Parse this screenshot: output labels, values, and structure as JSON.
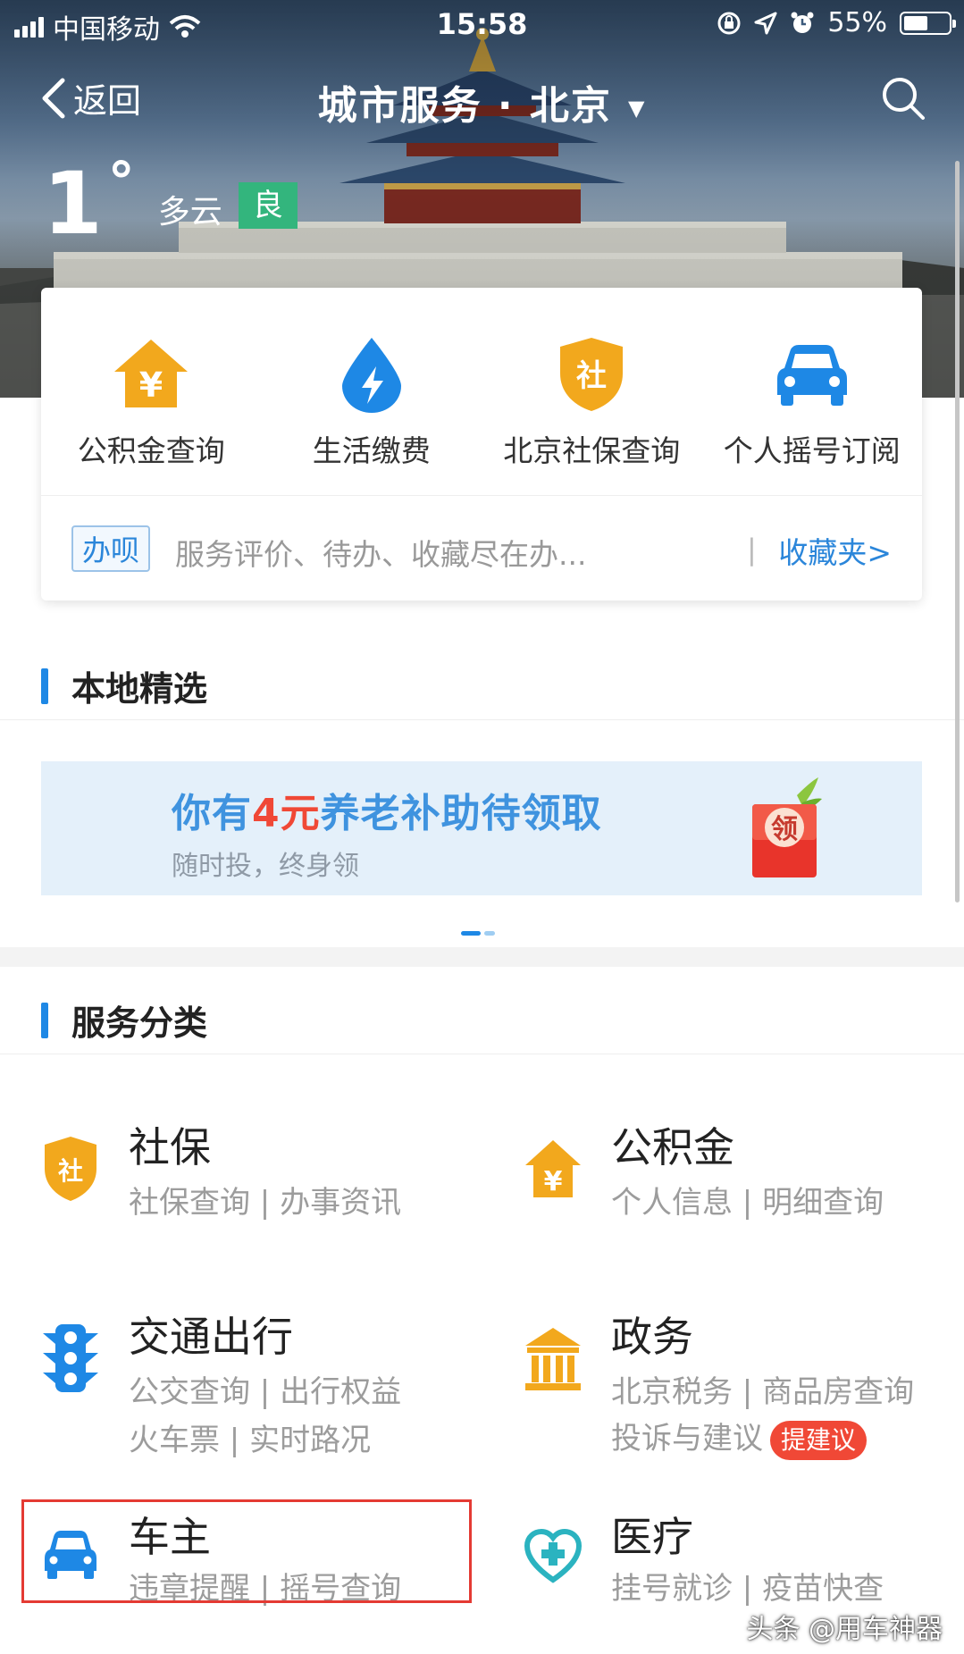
{
  "status_bar": {
    "carrier": "中国移动",
    "time": "15:58",
    "battery_percent": "55%",
    "battery_level": 0.55,
    "icons": [
      "signal-icon",
      "wifi-icon",
      "orientation-lock-icon",
      "location-icon",
      "alarm-icon",
      "battery-icon"
    ]
  },
  "nav": {
    "back_label": "返回",
    "title": "城市服务 · 北京",
    "dropdown_icon": "caret-down-icon",
    "search_icon": "search-icon"
  },
  "weather": {
    "temperature": "1",
    "degree_symbol": "°",
    "condition": "多云",
    "air_quality": "良",
    "air_quality_color": "#33b57d"
  },
  "quick_services": [
    {
      "label": "公积金查询",
      "icon": "house-yuan-icon",
      "color": "#f2a81d"
    },
    {
      "label": "生活缴费",
      "icon": "water-drop-bolt-icon",
      "color": "#1e88e5"
    },
    {
      "label": "北京社保查询",
      "icon": "shield-she-icon",
      "color": "#f2a81d"
    },
    {
      "label": "个人摇号订阅",
      "icon": "car-icon",
      "color": "#1e88e5"
    }
  ],
  "banjie": {
    "badge": "办呗",
    "text": "服务评价、待办、收藏尽在办...",
    "divider": "|",
    "favorites_link": "收藏夹>"
  },
  "local_selection": {
    "title": "本地精选",
    "promo": {
      "title_prefix": "你有",
      "title_highlight": "4元",
      "title_suffix": "养老补助待领取",
      "subtitle": "随时投，终身领",
      "envelope_text": "领"
    }
  },
  "categories_section": {
    "title": "服务分类",
    "items": [
      {
        "title": "社保",
        "lines": [
          "社保查询 | 办事资讯"
        ],
        "icon": "shield-she-icon"
      },
      {
        "title": "公积金",
        "lines": [
          "个人信息 | 明细查询"
        ],
        "icon": "house-yuan-icon"
      },
      {
        "title": "交通出行",
        "lines": [
          "公交查询 | 出行权益",
          "火车票 | 实时路况"
        ],
        "icon": "traffic-light-icon"
      },
      {
        "title": "政务",
        "lines": [
          "北京税务 | 商品房查询",
          "投诉与建议"
        ],
        "badge": "提建议",
        "icon": "government-building-icon"
      },
      {
        "title": "车主",
        "lines": [
          "违章提醒 | 摇号查询"
        ],
        "icon": "car-icon"
      },
      {
        "title": "医疗",
        "lines": [
          "挂号就诊 | 疫苗快查"
        ],
        "icon": "stethoscope-heart-icon"
      }
    ]
  },
  "colors": {
    "accent_blue": "#1e88e5",
    "accent_orange": "#f2a81d",
    "highlight_red": "#e43a33",
    "medical_teal": "#2bb3c0"
  },
  "watermark": "头条 @用车神器"
}
